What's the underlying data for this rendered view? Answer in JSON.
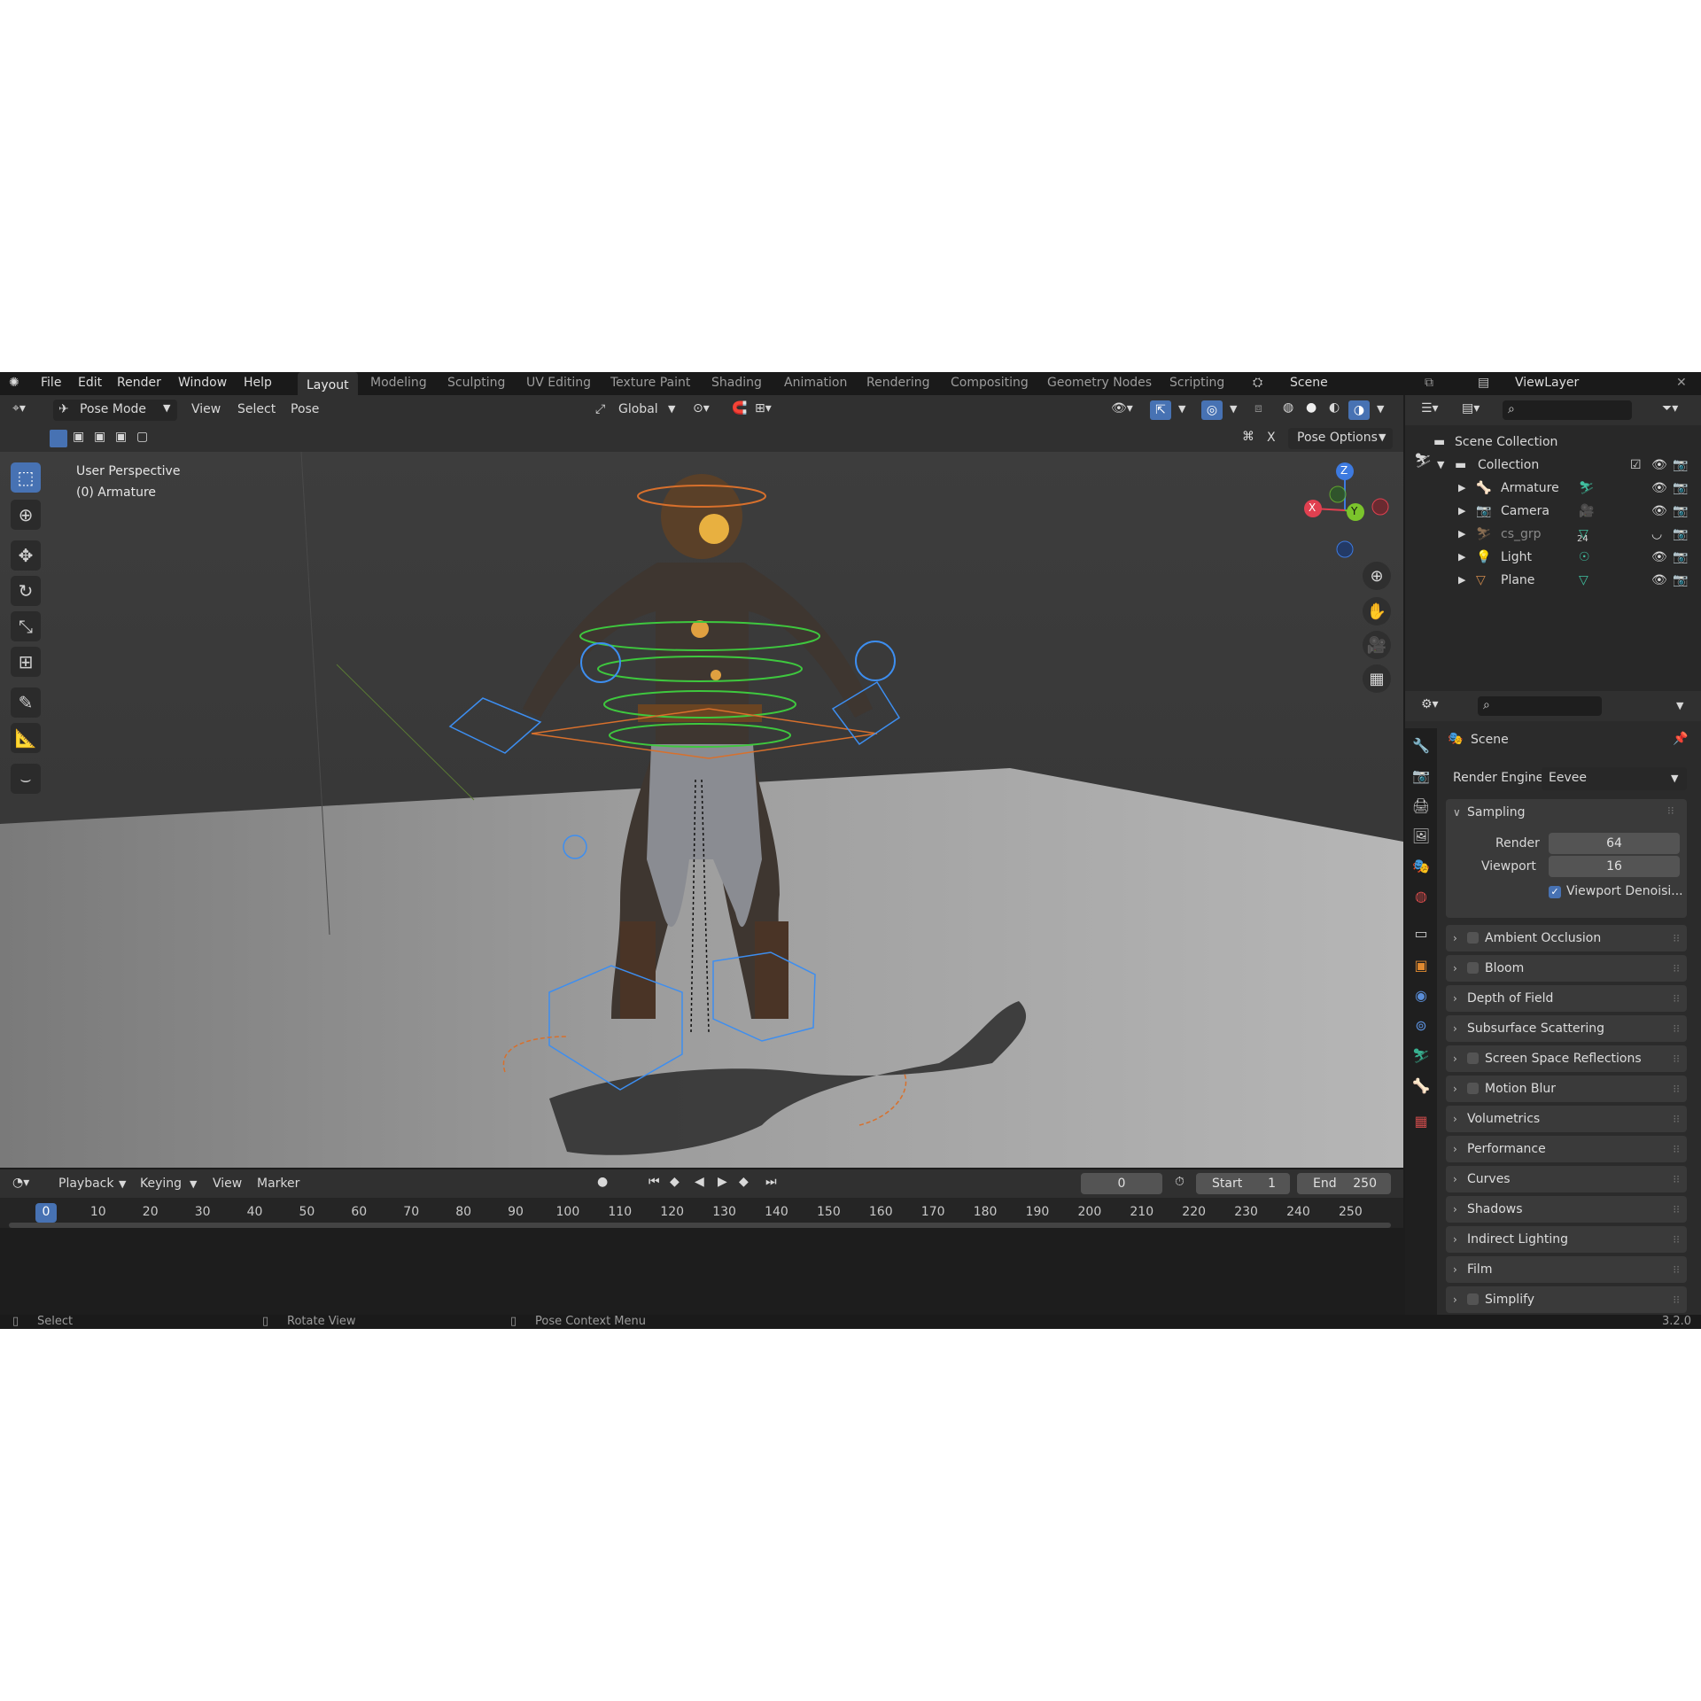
{
  "topbar": {
    "menus": [
      "File",
      "Edit",
      "Render",
      "Window",
      "Help"
    ],
    "workspaces": [
      "Layout",
      "Modeling",
      "Sculpting",
      "UV Editing",
      "Texture Paint",
      "Shading",
      "Animation",
      "Rendering",
      "Compositing",
      "Geometry Nodes",
      "Scripting"
    ],
    "active_workspace": "Layout",
    "scene": "Scene",
    "view_layer": "ViewLayer"
  },
  "viewport_header": {
    "mode": "Pose Mode",
    "menus": [
      "View",
      "Select",
      "Pose"
    ],
    "orientation": "Global",
    "pose_options": "Pose Options",
    "x_label": "X"
  },
  "viewport": {
    "perspective": "User Perspective",
    "object": "(0) Armature",
    "gizmo_axes": {
      "z": "Z",
      "y": "Y",
      "x": "X"
    }
  },
  "outliner": {
    "root": "Scene Collection",
    "collection": "Collection",
    "items": [
      {
        "name": "Armature",
        "color": "#d08a4c"
      },
      {
        "name": "Camera",
        "color": "#d08a4c"
      },
      {
        "name": "cs_grp",
        "color": "#8a6e52",
        "badge": "24"
      },
      {
        "name": "Light",
        "color": "#d08a4c"
      },
      {
        "name": "Plane",
        "color": "#d08a4c"
      }
    ]
  },
  "properties": {
    "context": "Scene",
    "render_engine_label": "Render Engine",
    "render_engine": "Eevee",
    "sampling": {
      "title": "Sampling",
      "render_label": "Render",
      "render_value": "64",
      "viewport_label": "Viewport",
      "viewport_value": "16",
      "denoise_label": "Viewport Denoisi..."
    },
    "panels": [
      {
        "label": "Ambient Occlusion",
        "checkbox": true
      },
      {
        "label": "Bloom",
        "checkbox": true
      },
      {
        "label": "Depth of Field",
        "checkbox": false
      },
      {
        "label": "Subsurface Scattering",
        "checkbox": false
      },
      {
        "label": "Screen Space Reflections",
        "checkbox": true
      },
      {
        "label": "Motion Blur",
        "checkbox": true
      },
      {
        "label": "Volumetrics",
        "checkbox": false
      },
      {
        "label": "Performance",
        "checkbox": false
      },
      {
        "label": "Curves",
        "checkbox": false
      },
      {
        "label": "Shadows",
        "checkbox": false
      },
      {
        "label": "Indirect Lighting",
        "checkbox": false
      },
      {
        "label": "Film",
        "checkbox": false
      },
      {
        "label": "Simplify",
        "checkbox": true
      }
    ]
  },
  "timeline": {
    "menus": [
      "Playback",
      "Keying",
      "View",
      "Marker"
    ],
    "current_frame": "0",
    "start_label": "Start",
    "start": "1",
    "end_label": "End",
    "end": "250",
    "ticks": [
      "0",
      "10",
      "20",
      "30",
      "40",
      "50",
      "60",
      "70",
      "80",
      "90",
      "100",
      "110",
      "120",
      "130",
      "140",
      "150",
      "160",
      "170",
      "180",
      "190",
      "200",
      "210",
      "220",
      "230",
      "240",
      "250"
    ]
  },
  "statusbar": {
    "select": "Select",
    "rotate": "Rotate View",
    "context": "Pose Context Menu",
    "version": "3.2.0"
  },
  "colors": {
    "accent": "#4772b3",
    "bone_green": "#3ec83e",
    "bone_blue": "#3d8ef0",
    "bone_orange": "#d8702c"
  }
}
